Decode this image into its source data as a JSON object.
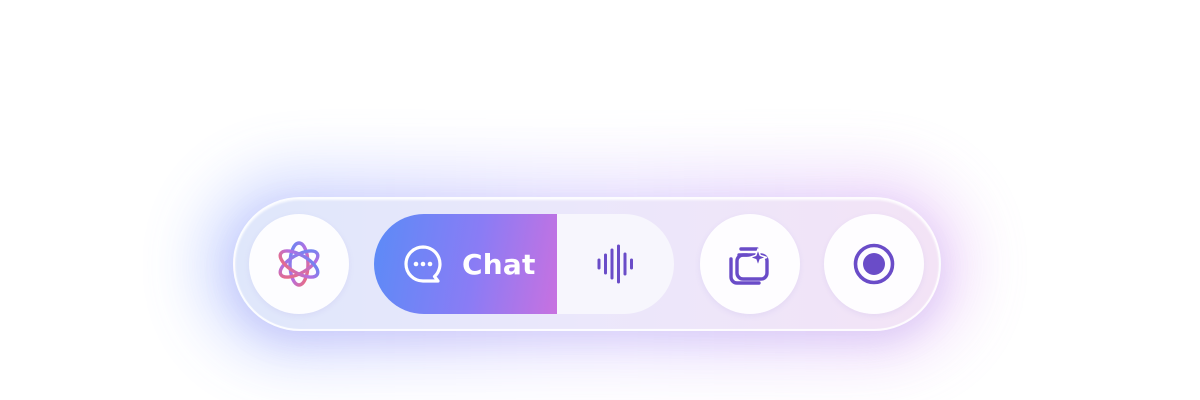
{
  "toolbar": {
    "chat_label": "Chat",
    "active_mode": "chat",
    "icons": {
      "logo": "interlaced-star-logo-icon",
      "chat": "chat-bubble-icon",
      "voice": "sound-wave-icon",
      "gallery": "sparkle-gallery-icon",
      "record": "record-icon"
    }
  },
  "colors": {
    "accent_start": "#5b8bf7",
    "accent_end": "#c871e0",
    "icon": "#6a4cc8"
  }
}
